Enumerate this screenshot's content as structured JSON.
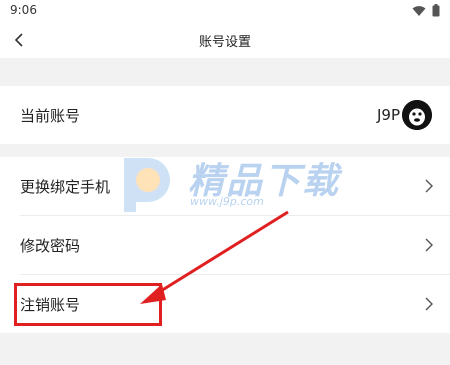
{
  "status_bar": {
    "time": "9:06",
    "icons": [
      "wifi-icon",
      "battery-icon"
    ]
  },
  "navbar": {
    "title": "账号设置",
    "back_icon": "chevron-left-icon"
  },
  "account": {
    "label": "当前账号",
    "name": "J9P",
    "avatar_icon": "monkey-avatar-icon"
  },
  "settings": {
    "items": [
      {
        "label": "更换绑定手机",
        "icon": "chevron-right-icon"
      },
      {
        "label": "修改密码",
        "icon": "chevron-right-icon"
      },
      {
        "label": "注销账号",
        "icon": "chevron-right-icon"
      }
    ]
  },
  "watermark": {
    "text": "精品下载",
    "url": "www.j9p.com"
  },
  "annotation": {
    "highlight_color": "#e02020"
  },
  "colors": {
    "background": "#f2f2f2",
    "card": "#ffffff",
    "divider": "#ececec",
    "watermark": "#b8d2f0"
  }
}
